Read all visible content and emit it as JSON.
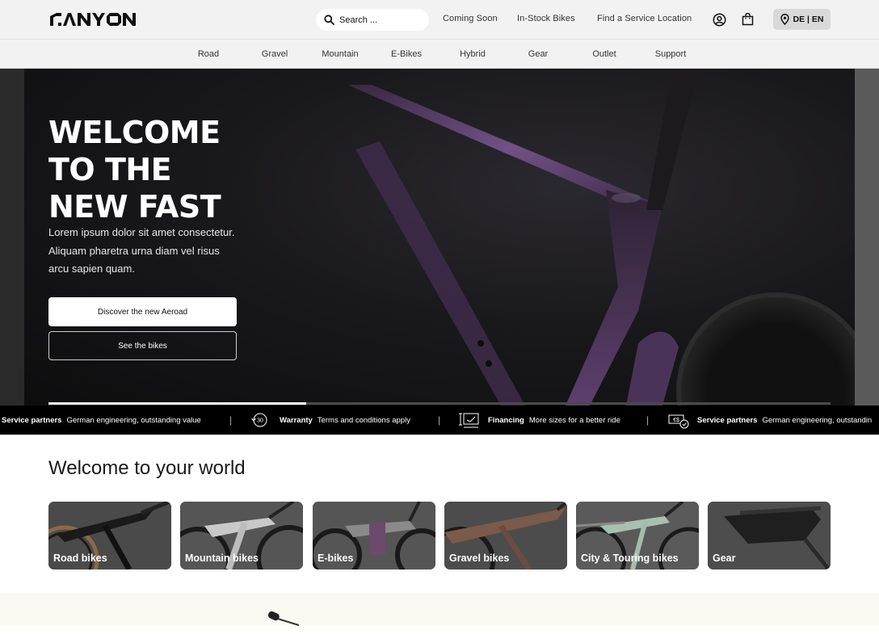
{
  "brand": {
    "logo_text": "CANYON"
  },
  "header": {
    "search_placeholder": "Search ...",
    "links": [
      "Coming Soon",
      "In-Stock Bikes",
      "Find a Service Location"
    ],
    "account_icon": "user-circle-icon",
    "cart_icon": "shopping-bag-icon",
    "locale": "DE | EN",
    "locale_icon": "map-pin-icon"
  },
  "nav": {
    "items": [
      "Road",
      "Gravel",
      "Mountain",
      "E-Bikes",
      "Hybrid",
      "Gear",
      "Outlet",
      "Support"
    ]
  },
  "hero": {
    "title": "WELCOME\nTO THE\nNEW FAST",
    "body": "Lorem ipsum dolor sit amet consectetur. Aliquam pharetra urna diam vel risus arcu sapien quam.",
    "primary_button": "Discover the new Aeroad",
    "secondary_button": "See the bikes",
    "slide_progress": 0.33
  },
  "ticker": {
    "items": [
      {
        "title": "Service partners",
        "text": "German engineering, outstanding value",
        "icon": ""
      },
      {
        "title": "Warranty",
        "text": "Terms and conditions apply",
        "icon": "30-day-return-icon"
      },
      {
        "title": "Financing",
        "text": "More sizes for a better ride",
        "icon": "bike-size-icon"
      },
      {
        "title": "Service partners",
        "text": "German engineering, outstandin",
        "icon": "money-check-icon"
      }
    ],
    "separator": "|"
  },
  "welcome": {
    "title": "Welcome to your world",
    "categories": [
      "Road bikes",
      "Mountain bikes",
      "E-bikes",
      "Gravel bikes",
      "City & Touring bikes",
      "Gear"
    ]
  },
  "colors": {
    "topbar": "#f2f2f2",
    "hero_bg": "#0f0f0f",
    "frame_purple": "#6b4a7e",
    "ticker_bg": "#000000",
    "cream": "#fbf9f1"
  }
}
